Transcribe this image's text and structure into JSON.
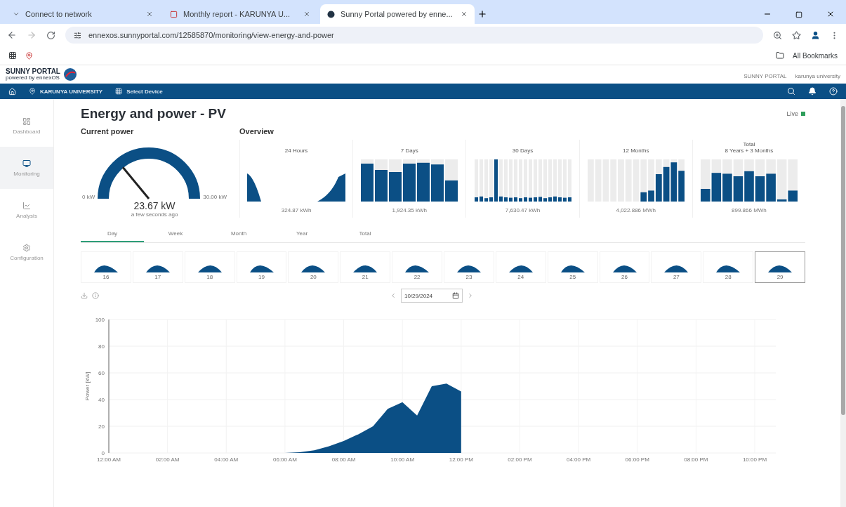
{
  "browser": {
    "tabs": [
      {
        "title": "Connect to network",
        "selected": false,
        "kind": "plain"
      },
      {
        "title": "Monthly report - KARUNYA U...",
        "selected": false,
        "kind": "report"
      },
      {
        "title": "Sunny Portal powered by enne...",
        "selected": true,
        "kind": "portal"
      }
    ],
    "url": "ennexos.sunnyportal.com/12585870/monitoring/view-energy-and-power",
    "bookmarks": "All Bookmarks"
  },
  "portal": {
    "logo": "SUNNY PORTAL",
    "logo_sub": "powered by ennexOS",
    "top_links": [
      "SUNNY PORTAL",
      "karunya university"
    ],
    "nav": [
      {
        "label": "KARUNYA UNIVERSITY",
        "kind": "plant"
      },
      {
        "label": "Select Device",
        "kind": "device"
      }
    ]
  },
  "sidebar": [
    {
      "label": "Dashboard",
      "kind": "dashboard",
      "selected": false
    },
    {
      "label": "Monitoring",
      "kind": "monitoring",
      "selected": true
    },
    {
      "label": "Analysis",
      "kind": "analysis",
      "selected": false
    },
    {
      "label": "Configuration",
      "kind": "configuration",
      "selected": false
    }
  ],
  "page": {
    "title": "Energy and power - PV",
    "live": "Live"
  },
  "current_power": {
    "heading": "Current power",
    "min": "0 kW",
    "max": "30.00 kW",
    "value": "23.67 kW",
    "updated": "a few seconds ago",
    "level": 0.28
  },
  "overview": {
    "heading": "Overview",
    "cards": [
      {
        "kind": "area",
        "title": "24 Hours",
        "total": "324.87 kWh"
      },
      {
        "kind": "week",
        "title": "7 Days",
        "total": "1,924.35 kWh"
      },
      {
        "kind": "month",
        "title": "30 Days",
        "total": "7,630.47 kWh"
      },
      {
        "kind": "year",
        "title": "12 Months",
        "total": "4,022.886 MWh"
      },
      {
        "kind": "total",
        "caption": "Total",
        "title": "8 Years + 3 Months",
        "total": "899.866 MWh"
      }
    ]
  },
  "period_tabs": [
    {
      "label": "Day",
      "selected": true
    },
    {
      "label": "Week",
      "selected": false
    },
    {
      "label": "Month",
      "selected": false
    },
    {
      "label": "Year",
      "selected": false
    },
    {
      "label": "Total",
      "selected": false
    }
  ],
  "days": [
    {
      "label": "16",
      "selected": false
    },
    {
      "label": "17",
      "selected": false
    },
    {
      "label": "18",
      "selected": false
    },
    {
      "label": "19",
      "selected": false
    },
    {
      "label": "20",
      "selected": false
    },
    {
      "label": "21",
      "selected": false
    },
    {
      "label": "22",
      "selected": false
    },
    {
      "label": "23",
      "selected": false
    },
    {
      "label": "24",
      "selected": false
    },
    {
      "label": "25",
      "selected": false
    },
    {
      "label": "26",
      "selected": false
    },
    {
      "label": "27",
      "selected": false
    },
    {
      "label": "28",
      "selected": false
    },
    {
      "label": "29",
      "selected": true
    }
  ],
  "date": "10/29/2024",
  "chart_data": {
    "type": "area",
    "ylabel": "Power [kW]",
    "x": [
      0,
      6,
      6.5,
      7,
      7.5,
      8,
      8.5,
      9,
      9.5,
      10,
      10.5,
      11,
      11.5,
      12
    ],
    "grid": true,
    "series": [
      {
        "color": "#0b4f85",
        "values": [
          0,
          0,
          0.5,
          2,
          5,
          9,
          14,
          20,
          33,
          38,
          28,
          50,
          52,
          46
        ]
      }
    ],
    "xlim": [
      0,
      22
    ],
    "ylim": [
      0,
      100
    ],
    "yticks": [
      0,
      20,
      40,
      60,
      80,
      100
    ],
    "xticks": [
      {
        "value": 0,
        "label": "12:00 AM"
      },
      {
        "value": 2,
        "label": "02:00 AM"
      },
      {
        "value": 4,
        "label": "04:00 AM"
      },
      {
        "value": 6,
        "label": "06:00 AM"
      },
      {
        "value": 8,
        "label": "08:00 AM"
      },
      {
        "value": 10,
        "label": "10:00 AM"
      },
      {
        "value": 12,
        "label": "12:00 PM"
      },
      {
        "value": 14,
        "label": "02:00 PM"
      },
      {
        "value": 16,
        "label": "04:00 PM"
      },
      {
        "value": 18,
        "label": "06:00 PM"
      },
      {
        "value": 20,
        "label": "08:00 PM"
      },
      {
        "value": 22,
        "label": "10:00 PM"
      }
    ]
  }
}
